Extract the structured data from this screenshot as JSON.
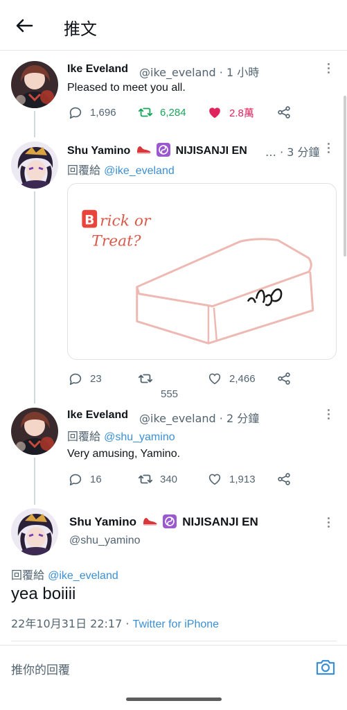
{
  "header": {
    "title": "推文"
  },
  "tweets": [
    {
      "name": "Ike Eveland",
      "meta": "@ike_eveland · 1 小時",
      "text": "Pleased to meet you all.",
      "replies": "1,696",
      "retweets": "6,284",
      "likes": "2.8萬",
      "liked": true,
      "retweeted": true
    },
    {
      "name": "Shu Yamino",
      "name_suffix": "NIJISANJI EN",
      "meta": "… · 3 分鐘",
      "reply_prefix": "回覆給 ",
      "reply_handle": "@ike_eveland",
      "media_text": [
        "rick or",
        "Treat?"
      ],
      "media_letter": "B",
      "replies": "23",
      "retweets": "555",
      "likes": "2,466"
    },
    {
      "name": "Ike Eveland",
      "meta": "@ike_eveland · 2 分鐘",
      "reply_prefix": "回覆給 ",
      "reply_handle": "@shu_yamino",
      "text": "Very amusing, Yamino.",
      "replies": "16",
      "retweets": "340",
      "likes": "1,913"
    }
  ],
  "main_tweet": {
    "name": "Shu Yamino",
    "name_suffix": "NIJISANJI EN",
    "handle": "@shu_yamino",
    "reply_prefix": "回覆給 ",
    "reply_handle": "@ike_eveland",
    "text": "yea boiiii",
    "timestamp": "22年10月31日 22:17 · ",
    "client": "Twitter for iPhone"
  },
  "compose": {
    "placeholder": "推你的回覆"
  },
  "icons": {
    "back": "arrow-left-icon",
    "reply": "speech-bubble-icon",
    "retweet": "retweet-icon",
    "like": "heart-icon",
    "share": "share-icon",
    "more": "vertical-dots-icon",
    "camera": "camera-icon"
  },
  "colors": {
    "accent": "#3b8fd6",
    "retweet_active": "#17a65a",
    "like_active": "#e0245e",
    "secondary_text": "#536471"
  }
}
